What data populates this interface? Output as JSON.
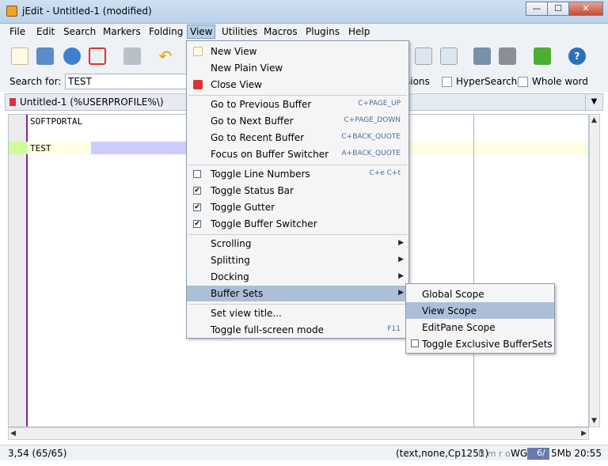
{
  "window": {
    "title": "jEdit - Untitled-1 (modified)",
    "min": "—",
    "max": "☐",
    "close": "✕"
  },
  "menubar": [
    "File",
    "Edit",
    "Search",
    "Markers",
    "Folding",
    "View",
    "Utilities",
    "Macros",
    "Plugins",
    "Help"
  ],
  "search": {
    "label": "Search for:",
    "value": "TEST",
    "opt1": "sions",
    "opt2": "HyperSearch",
    "opt3": "Whole word"
  },
  "buffer": {
    "label": "Untitled-1 (%USERPROFILE%\\)"
  },
  "editor": {
    "lines": [
      "SOFTPORTAL",
      "",
      "TEST"
    ]
  },
  "status": {
    "position": "3,54 (65/65)",
    "mode": "(text,none,Cp1251)",
    "flags": "N m r o",
    "wg": "WG",
    "mem": "6/",
    "mem2": "5Mb",
    "time": "20:55",
    "mem_used_fraction": 0.55
  },
  "view_menu": {
    "new_view": "New View",
    "new_plain_view": "New Plain View",
    "close_view": "Close View",
    "prev_buffer": "Go to Previous Buffer",
    "prev_buffer_accel": "C+PAGE_UP",
    "next_buffer": "Go to Next Buffer",
    "next_buffer_accel": "C+PAGE_DOWN",
    "recent_buffer": "Go to Recent Buffer",
    "recent_buffer_accel": "C+BACK_QUOTE",
    "focus_switcher": "Focus on Buffer Switcher",
    "focus_switcher_accel": "A+BACK_QUOTE",
    "toggle_line_numbers": "Toggle Line Numbers",
    "toggle_line_numbers_accel": "C+e C+t",
    "toggle_status_bar": "Toggle Status Bar",
    "toggle_gutter": "Toggle Gutter",
    "toggle_buffer_switcher": "Toggle Buffer Switcher",
    "scrolling": "Scrolling",
    "splitting": "Splitting",
    "docking": "Docking",
    "buffer_sets": "Buffer Sets",
    "set_view_title": "Set view title...",
    "toggle_fullscreen": "Toggle full-screen mode",
    "toggle_fullscreen_accel": "F11"
  },
  "buffer_sets_menu": {
    "global_scope": "Global Scope",
    "view_scope": "View Scope",
    "editpane_scope": "EditPane Scope",
    "toggle_exclusive": "Toggle Exclusive BufferSets"
  }
}
